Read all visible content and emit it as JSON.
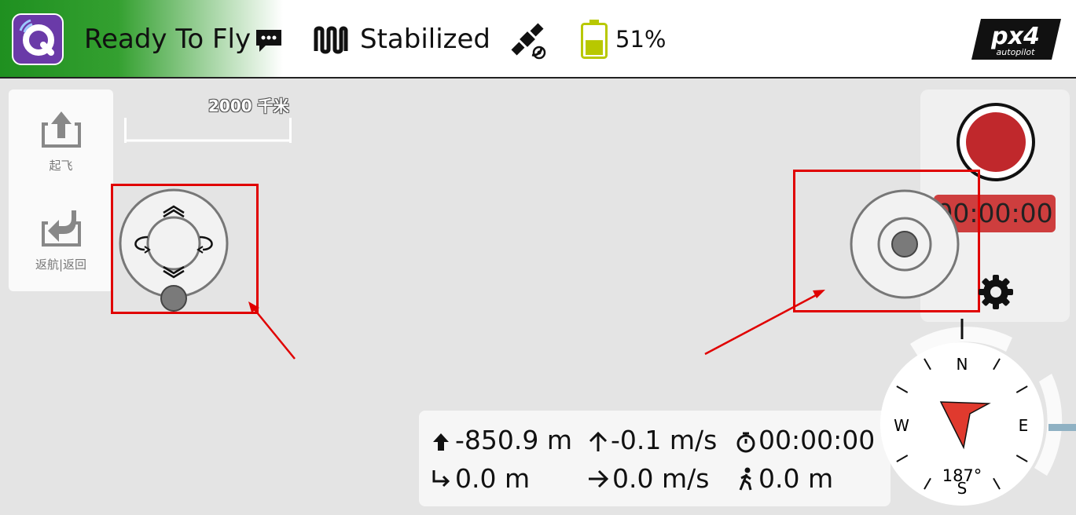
{
  "toolbar": {
    "status": "Ready To Fly",
    "flight_mode": "Stabilized",
    "battery_percent": "51%",
    "battery_level": 0.51,
    "icons": [
      "qgc-logo-icon",
      "message-icon",
      "flight-mode-icon",
      "gps-satellite-icon",
      "battery-icon",
      "px4-logo"
    ],
    "px4_logo_text": "px4",
    "px4_logo_sub": "autopilot"
  },
  "toolstrip": {
    "takeoff_label": "起飞",
    "return_label": "返航|返回"
  },
  "map": {
    "scale_label": "2000 千米"
  },
  "record": {
    "time": "00:00:00"
  },
  "telemetry": {
    "altitude": "-850.9 m",
    "vertical_speed": "-0.1 m/s",
    "flight_time": "00:00:00",
    "distance": "0.0 m",
    "horizontal_speed": "0.0 m/s",
    "home_distance": "0.0 m"
  },
  "compass": {
    "n": "N",
    "e": "E",
    "s": "S",
    "w": "W",
    "heading": "187°"
  },
  "colors": {
    "accent_green": "#1f9020",
    "record_red": "#c0282c",
    "highlight_box": "#e00000",
    "battery": "#b8c800"
  }
}
